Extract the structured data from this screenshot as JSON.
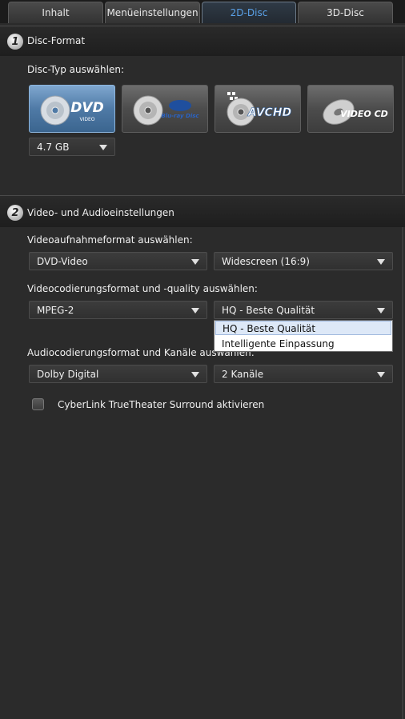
{
  "tabs": [
    {
      "label": "Inhalt",
      "active": false
    },
    {
      "label": "Menüeinstellungen",
      "active": false
    },
    {
      "label": "2D-Disc",
      "active": true
    },
    {
      "label": "3D-Disc",
      "active": false
    }
  ],
  "section1": {
    "number": "1",
    "title": "Disc-Format",
    "disc_type_label": "Disc-Typ auswählen:",
    "disc_types": [
      {
        "logo_text": "DVD",
        "sub_text": "VIDEO",
        "icon": "dvd-video-icon",
        "selected": true
      },
      {
        "logo_text": "Blu-ray Disc",
        "sub_text": "",
        "icon": "blu-ray-disc-icon",
        "selected": false
      },
      {
        "logo_text": "AVCHD",
        "sub_text": "",
        "icon": "avchd-icon",
        "selected": false
      },
      {
        "logo_text": "VIDEO CD",
        "sub_text": "",
        "icon": "video-cd-icon",
        "selected": false
      }
    ],
    "capacity": {
      "value": "4.7 GB"
    }
  },
  "section2": {
    "number": "2",
    "title": "Video- und Audioeinstellungen",
    "video_record_label": "Videoaufnahmeformat auswählen:",
    "video_record_format": "DVD-Video",
    "aspect_ratio": "Widescreen (16:9)",
    "video_codec_label": "Videocodierungsformat und -quality auswählen:",
    "video_codec": "MPEG-2",
    "quality": "HQ - Beste Qualität",
    "quality_options": [
      "HQ - Beste Qualität",
      "Intelligente Einpassung"
    ],
    "audio_label": "Audiocodierungsformat und Kanäle auswählen:",
    "audio_codec": "Dolby Digital",
    "audio_channels": "2 Kanäle",
    "surround_checkbox_label": "CyberLink TrueTheater Surround aktivieren",
    "surround_checked": false
  },
  "colors": {
    "background": "#2b2b2b",
    "active_tab_text": "#5aa0e6",
    "selected_disc": "#4f7aa6",
    "dropdown_highlight": "#dde8f7"
  }
}
